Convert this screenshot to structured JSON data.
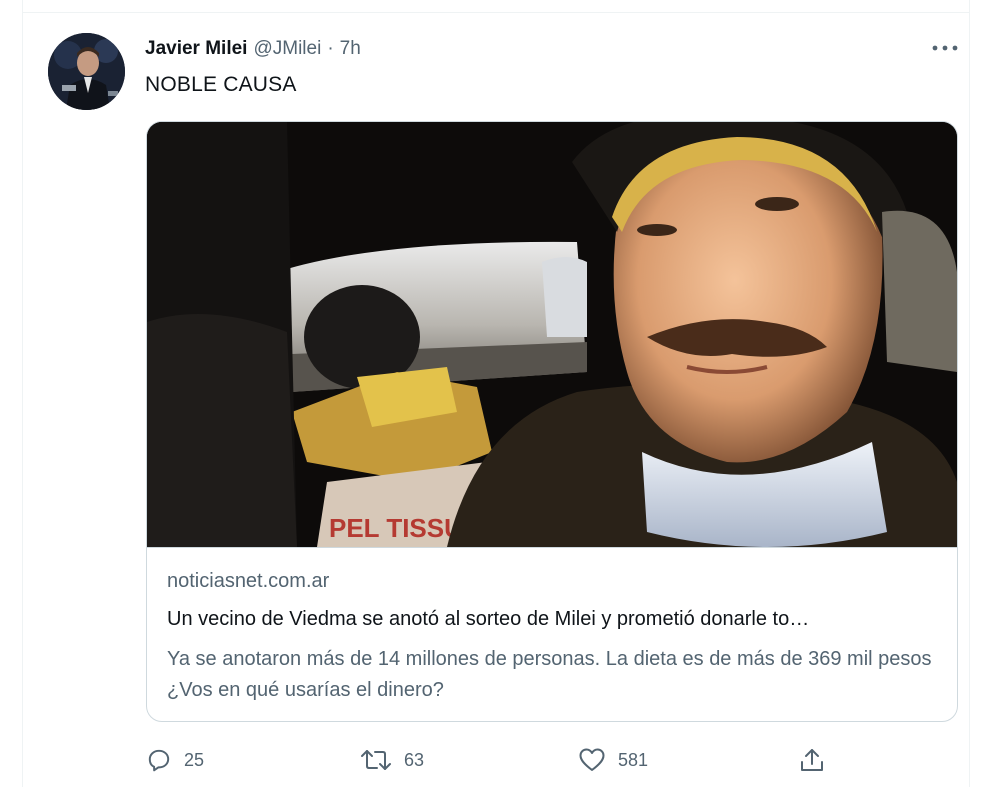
{
  "tweet": {
    "author_name": "Javier Milei",
    "author_handle": "@JMilei",
    "separator": "·",
    "time": "7h",
    "more_icon": "more-horizontal-icon",
    "text": "NOBLE CAUSA"
  },
  "card": {
    "image_caption_text": "PEL TISSU",
    "domain": "noticiasnet.com.ar",
    "title": "Un vecino de Viedma se anotó al sorteo de Milei y prometió donarle to…",
    "description": "Ya se anotaron más de 14 millones de personas. La dieta es de más de 369 mil pesos ¿Vos en qué usarías el dinero?"
  },
  "actions": {
    "reply_count": "25",
    "retweet_count": "63",
    "like_count": "581",
    "reply_icon": "reply-icon",
    "retweet_icon": "retweet-icon",
    "like_icon": "heart-icon",
    "share_icon": "share-icon"
  },
  "colors": {
    "text_primary": "#0f1419",
    "text_secondary": "#536471",
    "border": "#cfd9de"
  }
}
